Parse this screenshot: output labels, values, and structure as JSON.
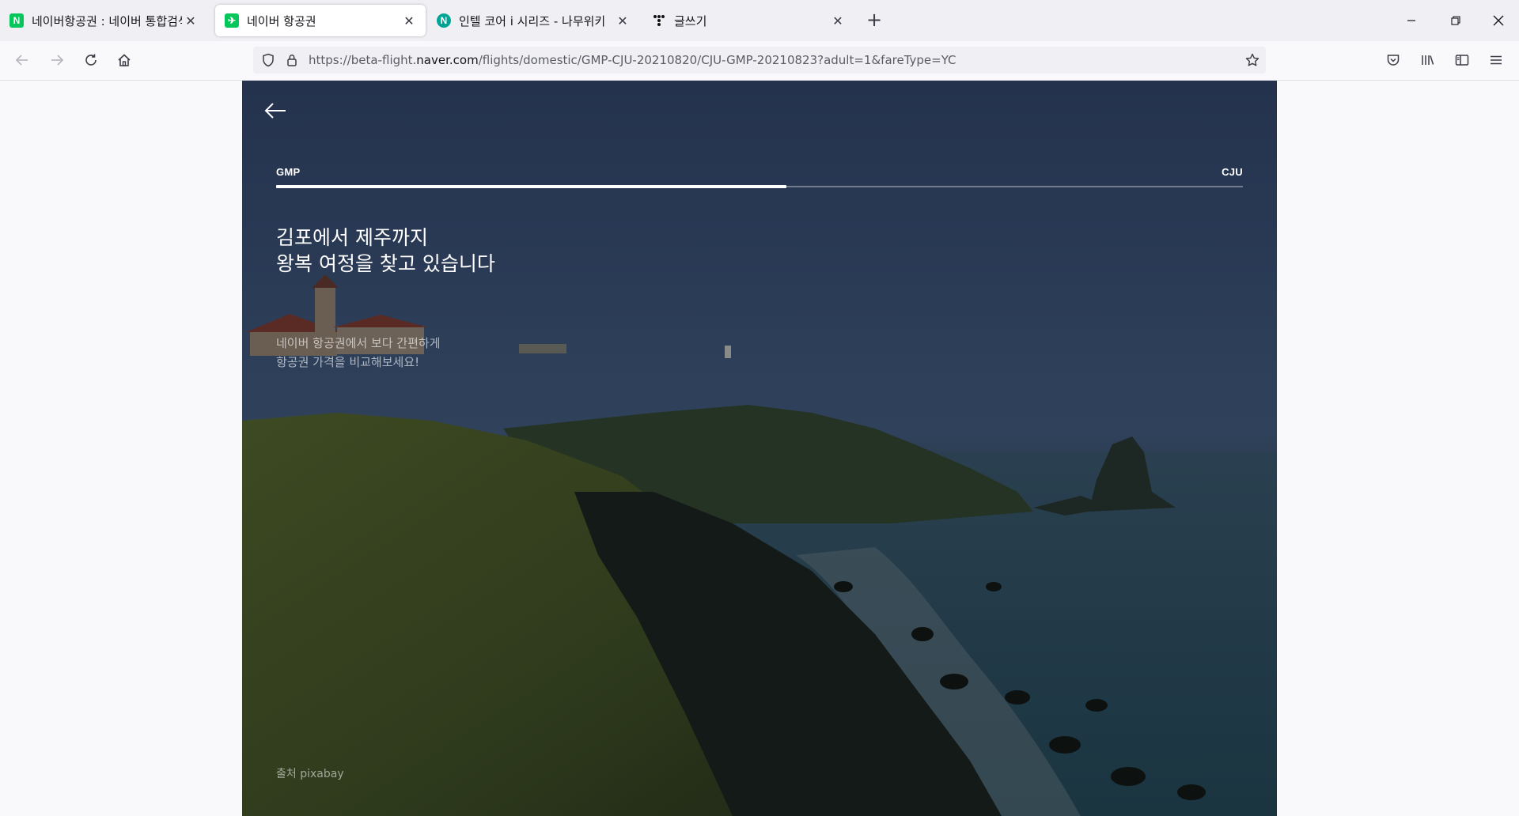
{
  "browser": {
    "tabs": [
      {
        "title": "네이버항공권 : 네이버 통합검색",
        "favicon": "N",
        "favicon_color": "#03c75a",
        "active": false
      },
      {
        "title": "네이버 항공권",
        "favicon": "✈",
        "favicon_color": "#03c75a",
        "active": true
      },
      {
        "title": "인텔 코어 i 시리즈 - 나무위키",
        "favicon": "N",
        "favicon_color": "#00a495",
        "active": false
      },
      {
        "title": "글쓰기",
        "favicon": "T",
        "favicon_color": "#000000",
        "active": false
      }
    ],
    "url_prefix": "https://beta-flight.",
    "url_domain": "naver.com",
    "url_path": "/flights/domestic/GMP-CJU-20210820/CJU-GMP-20210823?adult=1&fareType=YC"
  },
  "page": {
    "origin_code": "GMP",
    "destination_code": "CJU",
    "search_progress": 0.528,
    "headline_line1": "김포에서 제주까지",
    "headline_line2": "왕복 여정을 찾고 있습니다",
    "sub_line1": "네이버 항공권에서 보다 간편하게",
    "sub_line2": "항공권 가격을 비교해보세요!",
    "photo_credit": "출처 pixabay"
  }
}
